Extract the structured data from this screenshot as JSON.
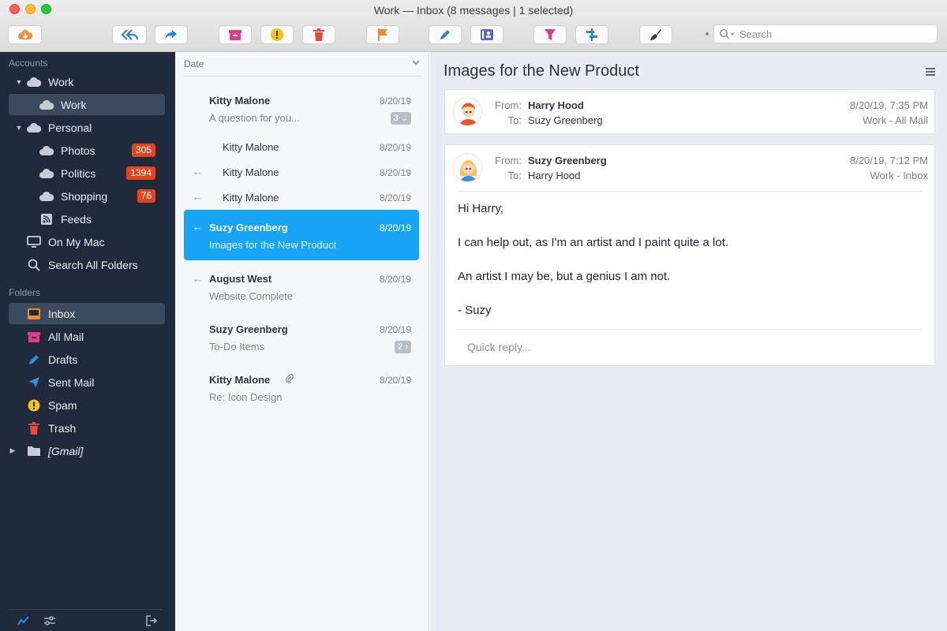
{
  "window": {
    "title": "Work — Inbox (8 messages | 1 selected)"
  },
  "toolbar": {
    "search_placeholder": "Search",
    "buttons": [
      "cloud-download-icon",
      "reply-all-icon",
      "forward-icon",
      "archive-icon",
      "spam-icon",
      "trash-icon",
      "flag-icon",
      "compose-icon",
      "contact-card-icon",
      "filter-icon",
      "columns-icon",
      "brush-icon"
    ]
  },
  "sidebar": {
    "accounts_label": "Accounts",
    "folders_label": "Folders",
    "accounts": [
      {
        "label": "Work"
      },
      {
        "label": "Work"
      },
      {
        "label": "Personal"
      },
      {
        "label": "Photos",
        "badge": "305"
      },
      {
        "label": "Politics",
        "badge": "1394"
      },
      {
        "label": "Shopping",
        "badge": "76"
      },
      {
        "label": "Feeds"
      },
      {
        "label": "On My Mac"
      },
      {
        "label": "Search All Folders"
      }
    ],
    "folders": [
      {
        "label": "Inbox"
      },
      {
        "label": "All Mail"
      },
      {
        "label": "Drafts"
      },
      {
        "label": "Sent Mail"
      },
      {
        "label": "Spam"
      },
      {
        "label": "Trash"
      },
      {
        "label": "[Gmail]"
      }
    ]
  },
  "list": {
    "sort_label": "Date",
    "messages": [
      {
        "sender": "Kitty Malone",
        "date": "8/20/19",
        "subject": "A question for you...",
        "count": "3"
      },
      {
        "sender": "Kitty Malone",
        "date": "8/20/19"
      },
      {
        "sender": "Kitty Malone",
        "date": "8/20/19"
      },
      {
        "sender": "Kitty Malone",
        "date": "8/20/19"
      },
      {
        "sender": "Suzy Greenberg",
        "date": "8/20/19",
        "subject": "Images for the New Product"
      },
      {
        "sender": "August West",
        "date": "8/20/19",
        "subject": "Website Complete"
      },
      {
        "sender": "Suzy Greenberg",
        "date": "8/20/19",
        "subject": "To-Do Items",
        "count": "2"
      },
      {
        "sender": "Kitty Malone",
        "date": "8/20/19",
        "subject": "Re: Icon Design"
      }
    ]
  },
  "reader": {
    "subject": "Images for the New Product",
    "from_label": "From:",
    "to_label": "To:",
    "messages": [
      {
        "from": "Harry Hood",
        "to": "Suzy Greenberg",
        "date": "8/20/19, 7:35 PM",
        "folder": "Work - All Mail"
      },
      {
        "from": "Suzy Greenberg",
        "to": "Harry Hood",
        "date": "8/20/19, 7:12 PM",
        "folder": "Work - Inbox",
        "body": [
          "Hi Harry,",
          "I can help out, as I'm an artist and I paint quite a lot.",
          "An artist I may be, but a genius I am not.",
          "- Suzy"
        ]
      }
    ],
    "quick_reply_placeholder": "Quick reply..."
  }
}
